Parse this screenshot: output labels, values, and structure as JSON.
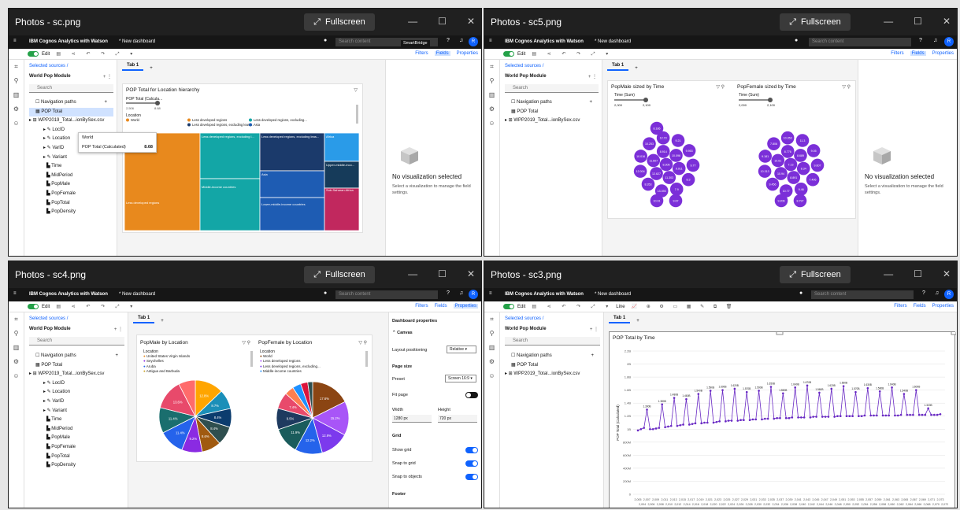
{
  "windows": [
    {
      "title": "Photos - sc.png",
      "fullscreen": "Fullscreen"
    },
    {
      "title": "Photos - sc5.png",
      "fullscreen": "Fullscreen"
    },
    {
      "title": "Photos - sc4.png",
      "fullscreen": "Fullscreen"
    },
    {
      "title": "Photos - sc3.png",
      "fullscreen": "Fullscreen"
    }
  ],
  "app": {
    "brand": "IBM Cognos Analytics with Watson",
    "dashboard": "* New dashboard",
    "search_placeholder": "Search content",
    "edit_label": "Edit",
    "filters": "Filters",
    "fields": "Fields",
    "properties": "Properties",
    "selected_sources": "Selected sources  /",
    "module": "World Pop Module",
    "search": "Search",
    "tab": "Tab 1",
    "tooltip_title": "SmartBridge",
    "line_label": "Line",
    "tree_full": [
      "Navigation paths",
      "POP Total",
      "WPP2019_Total...ionBySex.csv",
      "LocID",
      "Location",
      "VarID",
      "Variant",
      "Time",
      "MidPeriod",
      "PopMale",
      "PopFemale",
      "PopTotal",
      "PopDensity"
    ],
    "tree_short": [
      "Navigation paths",
      "POP Total",
      "WPP2019_Total...ionBySex.csv"
    ]
  },
  "novis": {
    "heading": "No visualization selected",
    "text": "Select a visualization to manage the field settings."
  },
  "treemap": {
    "title": "POP Total for Location hierarchy",
    "size_label": "POP Total (Calcula...",
    "slider_min": "2,506",
    "slider_max": "8.68",
    "legend_title": "Location",
    "legend": [
      "World",
      "Less developed regions",
      "Less developed regions, excluding...",
      "Less developed regions, excluding least...",
      "Asia"
    ],
    "tooltip": {
      "name": "World",
      "measure": "POP Total (Calculated)",
      "value": "8.68"
    },
    "blocks": [
      "Less developed regions",
      "Less developed regions, excluding l...",
      "Less developed regions, excluding leas...",
      "Africa",
      "Middle-income countries",
      "Asia",
      "Upper-middle-inco...",
      "Lower-middle-income countries",
      "Sub-Saharan Africa"
    ],
    "colors": {
      "orange": "#e8891d",
      "teal": "#13a6a6",
      "navy": "#1b3a6b",
      "blue": "#1e5cb3",
      "sky": "#2a9be8",
      "pink": "#c1285e",
      "dark": "#163b5a"
    }
  },
  "bubbles": {
    "male": {
      "title": "PopMale sized by Time",
      "slider_label": "Time (Sum)",
      "slider_min": "2,000",
      "slider_max": "2,100"
    },
    "female": {
      "title": "PopFemale sized by Time",
      "slider_label": "Time (Sum)",
      "slider_min": "2,000",
      "slider_max": "2,100"
    },
    "color": "#7b2fd8"
  },
  "pies": {
    "male": {
      "title": "PopMale by Location",
      "legend_title": "Location",
      "legend": [
        "United States Virgin Islands",
        "Seychelles",
        "Aruba",
        "Antigua and Barbuda"
      ],
      "chart_data": {
        "type": "pie",
        "labels_shown": [
          "12.8%",
          "8.7%",
          "8.4%",
          "8.4%",
          "8.6%",
          "9.2%",
          "11.4%",
          "11.4%",
          "13.6%"
        ],
        "values": [
          12.8,
          8.7,
          8.4,
          8.4,
          8.6,
          9.2,
          11.4,
          11.4,
          13.6,
          7.5
        ],
        "colors": [
          "#ffa500",
          "#1b8fb8",
          "#0b3c6e",
          "#2f4f4f",
          "#a05a10",
          "#8a2be2",
          "#2563eb",
          "#1a6e6e",
          "#e84a6b",
          "#ff6b6b"
        ]
      }
    },
    "female": {
      "title": "PopFemale by Location",
      "legend_title": "Location",
      "legend": [
        "World",
        "Less developed regions",
        "Less developed regions, excluding...",
        "Middle-income countries"
      ],
      "chart_data": {
        "type": "pie",
        "labels_shown": [
          "17.6%",
          "15.2%",
          "12.9%",
          "12.2%",
          "11.9%",
          "9.5%",
          "7.4%"
        ],
        "values": [
          17.6,
          15.2,
          12.9,
          12.2,
          11.9,
          9.5,
          7.4,
          4.1,
          3.8,
          3.2,
          2.2
        ],
        "colors": [
          "#8b4513",
          "#a855f7",
          "#7c3aed",
          "#2563eb",
          "#1a5c5c",
          "#1e3a5f",
          "#e84a6b",
          "#ff7f50",
          "#1e90ff",
          "#dc143c",
          "#2f4f4f"
        ]
      }
    }
  },
  "props": {
    "header": "Dashboard properties",
    "canvas": "Canvas",
    "layout": "Layout positioning",
    "layout_val": "Relative",
    "page_size": "Page size",
    "preset": "Preset",
    "preset_val": "Screen 16:9",
    "fit": "Fit page",
    "width": "Width",
    "width_val": "1280 px",
    "height": "Height",
    "height_val": "720 px",
    "grid": "Grid",
    "show_grid": "Show grid",
    "snap_grid": "Snap to grid",
    "snap_obj": "Snap to objects",
    "footer": "Footer"
  },
  "line": {
    "title": "POP Total by Time",
    "ylabel": "POP Total (Calculated)",
    "chart_data": {
      "type": "line",
      "yticks": [
        "0",
        "200M",
        "400M",
        "600M",
        "800M",
        "1B",
        "1.2B",
        "1.4B",
        "1.6B",
        "1.8B",
        "2B",
        "2.2B"
      ],
      "ylim": [
        0,
        2.2
      ],
      "x": [
        1,
        2,
        3,
        4,
        5,
        6,
        7,
        8,
        9,
        10,
        11,
        12,
        13,
        14,
        15,
        16,
        17,
        18,
        19,
        20,
        21,
        22,
        23,
        24,
        25,
        26,
        27,
        28,
        29,
        30,
        31,
        32,
        33,
        34,
        35,
        36,
        37,
        38,
        39,
        40,
        41,
        42,
        43,
        44,
        45,
        46,
        47,
        48,
        49,
        50,
        51,
        52,
        53,
        54,
        55,
        56,
        57,
        58,
        59,
        60,
        61,
        62,
        63,
        64,
        65,
        66,
        67,
        68,
        69,
        70,
        71,
        72,
        73,
        74,
        75,
        76,
        77,
        78,
        79,
        80,
        81,
        82,
        83,
        84,
        85,
        86,
        87,
        88,
        89,
        90,
        91,
        92,
        93,
        94,
        95,
        96,
        97,
        98,
        99,
        100,
        101
      ],
      "values": [
        0.98,
        1.0,
        1.02,
        1.3,
        1.0,
        1.0,
        1.01,
        1.02,
        1.38,
        1.03,
        1.04,
        1.05,
        1.48,
        1.05,
        1.06,
        1.07,
        1.46,
        1.07,
        1.08,
        1.09,
        1.54,
        1.09,
        1.1,
        1.1,
        1.59,
        1.1,
        1.11,
        1.12,
        1.6,
        1.12,
        1.13,
        1.13,
        1.62,
        1.13,
        1.14,
        1.14,
        1.57,
        1.14,
        1.15,
        1.15,
        1.59,
        1.15,
        1.16,
        1.16,
        1.65,
        1.16,
        1.17,
        1.17,
        1.55,
        1.17,
        1.17,
        1.18,
        1.64,
        1.18,
        1.18,
        1.18,
        1.67,
        1.18,
        1.19,
        1.19,
        1.56,
        1.19,
        1.19,
        1.19,
        1.62,
        1.19,
        1.2,
        1.2,
        1.66,
        1.2,
        1.2,
        1.2,
        1.57,
        1.2,
        1.2,
        1.21,
        1.63,
        1.21,
        1.21,
        1.21,
        1.58,
        1.21,
        1.21,
        1.21,
        1.64,
        1.21,
        1.21,
        1.22,
        1.54,
        1.22,
        1.22,
        1.22,
        1.6,
        1.22,
        1.22,
        1.22,
        1.32,
        1.22,
        1.22,
        1.22,
        1.23
      ],
      "xlabels_top": [
        "2,005",
        "2,007",
        "2,009",
        "2,011",
        "2,013",
        "2,015",
        "2,017",
        "2,019",
        "2,021",
        "2,023",
        "2,025",
        "2,027",
        "2,029",
        "2,031",
        "2,033",
        "2,035",
        "2,037",
        "2,039",
        "2,041",
        "2,043",
        "2,045",
        "2,047",
        "2,049",
        "2,051",
        "2,053",
        "2,055",
        "2,057",
        "2,059",
        "2,061",
        "2,063",
        "2,065",
        "2,067",
        "2,069",
        "2,071",
        "2,073"
      ],
      "xlabels_bottom": [
        "2,004",
        "2,006",
        "2,008",
        "2,010",
        "2,012",
        "2,014",
        "2,016",
        "2,018",
        "2,020",
        "2,022",
        "2,024",
        "2,026",
        "2,028",
        "2,030",
        "2,032",
        "2,034",
        "2,036",
        "2,038",
        "2,040",
        "2,042",
        "2,044",
        "2,046",
        "2,048",
        "2,050",
        "2,052",
        "2,054",
        "2,056",
        "2,058",
        "2,060",
        "2,062",
        "2,064",
        "2,066",
        "2,068",
        "2,070",
        "2,072"
      ],
      "color": "#6929c4"
    }
  }
}
